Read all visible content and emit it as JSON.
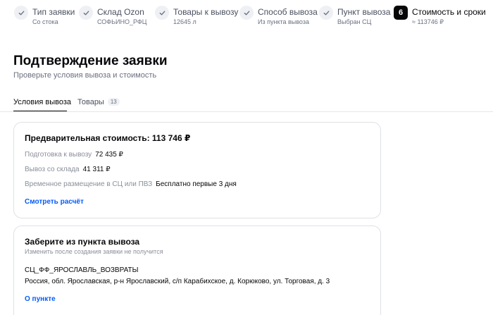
{
  "stepper": {
    "steps": [
      {
        "title": "Тип заявки",
        "sub": "Со стока"
      },
      {
        "title": "Склад Ozon",
        "sub": "СОФЬИНО_РФЦ"
      },
      {
        "title": "Товары к вывозу",
        "sub": "12645 л"
      },
      {
        "title": "Способ вывоза",
        "sub": "Из пункта вывоза"
      },
      {
        "title": "Пункт вывоза",
        "sub": "Выбран СЦ"
      },
      {
        "title": "Стоимость и сроки",
        "sub": "≈ 113746 ₽",
        "number": "6"
      }
    ]
  },
  "header": {
    "title": "Подтверждение заявки",
    "subtitle": "Проверьте условия вывоза и стоимость"
  },
  "tabs": [
    {
      "label": "Условия вывоза"
    },
    {
      "label": "Товары",
      "badge": "13"
    }
  ],
  "cost_card": {
    "title": "Предварительная стоимость: 113 746 ₽",
    "rows": [
      {
        "label": "Подготовка к вывозу",
        "value": "72 435 ₽"
      },
      {
        "label": "Вывоз со склада",
        "value": "41 311 ₽"
      },
      {
        "label": "Временное размещение в СЦ или ПВЗ",
        "value": "Бесплатно первые 3 дня"
      }
    ],
    "link": "Смотреть расчёт"
  },
  "pickup_card": {
    "title": "Заберите из пункта вывоза",
    "hint": "Изменить после создания заявки не получится",
    "point_name": "СЦ_ФФ_ЯРОСЛАВЛЬ_ВОЗВРАТЫ",
    "address": "Россия, обл. Ярославская, р-н Ярославский, с/п Карабихское, д. Корюково, ул. Торговая, д. 3",
    "link": "О пункте"
  }
}
